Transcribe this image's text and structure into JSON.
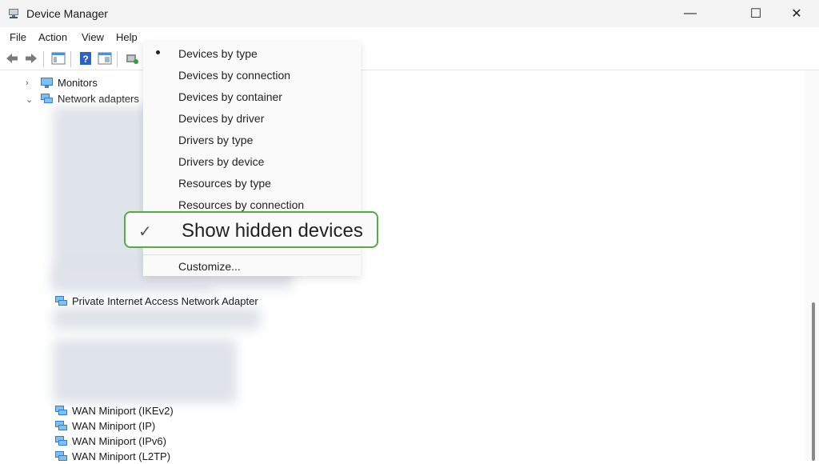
{
  "window": {
    "title": "Device Manager",
    "controls": {
      "minimize": "—",
      "maximize": "☐",
      "close": "✕"
    }
  },
  "menubar": {
    "items": [
      {
        "label": "File"
      },
      {
        "label": "Action"
      },
      {
        "label": "View"
      },
      {
        "label": "Help"
      }
    ]
  },
  "toolbar": {
    "icons": [
      "back-arrow-icon",
      "forward-arrow-icon",
      "properties-icon",
      "help-icon",
      "view-icon",
      "scan-hardware-icon"
    ]
  },
  "tree": {
    "monitors": {
      "label": "Monitors",
      "expanded": false
    },
    "network_adapters": {
      "label": "Network adapters",
      "expanded": true
    },
    "devices": [
      {
        "label": "Private Internet Access Network Adapter"
      },
      {
        "label": "WAN Miniport (IKEv2)"
      },
      {
        "label": "WAN Miniport (IP)"
      },
      {
        "label": "WAN Miniport (IPv6)"
      },
      {
        "label": "WAN Miniport (L2TP)"
      }
    ]
  },
  "view_menu": {
    "items": [
      {
        "label": "Devices by type",
        "selected": true
      },
      {
        "label": "Devices by connection",
        "selected": false
      },
      {
        "label": "Devices by container",
        "selected": false
      },
      {
        "label": "Devices by driver",
        "selected": false
      },
      {
        "label": "Drivers by type",
        "selected": false
      },
      {
        "label": "Drivers by device",
        "selected": false
      },
      {
        "label": "Resources by type",
        "selected": false
      },
      {
        "label": "Resources by connection",
        "selected": false
      }
    ],
    "show_hidden": {
      "label": "Show hidden devices",
      "checked": true
    },
    "customize": {
      "label": "Customize..."
    }
  },
  "colors": {
    "highlight_border": "#5aa84b",
    "titlebar": "#f3f3f3",
    "network_icon": "#2f7fd0"
  }
}
